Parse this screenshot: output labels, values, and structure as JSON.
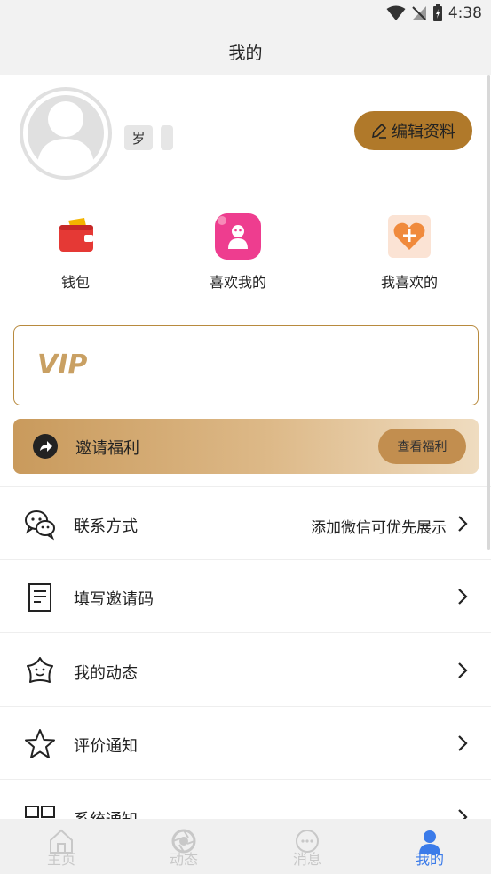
{
  "status": {
    "time": "4:38"
  },
  "header": {
    "title": "我的"
  },
  "profile": {
    "age_label": "岁",
    "edit_label": "编辑资料"
  },
  "quick_actions": [
    {
      "label": "钱包",
      "icon": "wallet-icon"
    },
    {
      "label": "喜欢我的",
      "icon": "liked-me-icon"
    },
    {
      "label": "我喜欢的",
      "icon": "heart-plus-icon"
    }
  ],
  "vip": {
    "label": "VIP"
  },
  "invite": {
    "label": "邀请福利",
    "button": "查看福利"
  },
  "menu": [
    {
      "label": "联系方式",
      "value": "添加微信可优先展示",
      "icon": "wechat-icon"
    },
    {
      "label": "填写邀请码",
      "value": "",
      "icon": "note-icon"
    },
    {
      "label": "我的动态",
      "value": "",
      "icon": "smile-star-icon"
    },
    {
      "label": "评价通知",
      "value": "",
      "icon": "star-icon"
    },
    {
      "label": "系统通知",
      "value": "",
      "icon": "book-icon"
    }
  ],
  "tabs": [
    {
      "label": "主页",
      "icon": "home-icon",
      "active": false
    },
    {
      "label": "动态",
      "icon": "aperture-icon",
      "active": false
    },
    {
      "label": "消息",
      "icon": "chat-icon",
      "active": false
    },
    {
      "label": "我的",
      "icon": "person-icon",
      "active": true
    }
  ],
  "colors": {
    "accent": "#b0792a",
    "vip_text": "#c9a063",
    "tab_active": "#3b7be9",
    "tab_inactive": "#c8c8c8"
  }
}
